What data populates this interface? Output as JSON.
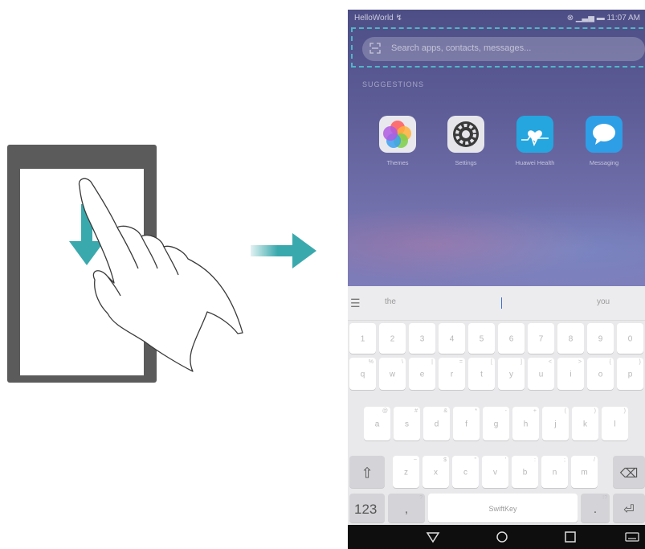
{
  "left_illustration": {
    "device": "tablet-outline",
    "gesture": "swipe-down-from-middle",
    "arrow_color": "#3aa9ad"
  },
  "transition_arrow": {
    "color": "#3aa9ad"
  },
  "phone": {
    "status_bar": {
      "carrier": "HelloWorld ↯",
      "right": "⊗ ▁▃▅ ▬ 11:07 AM"
    },
    "search": {
      "placeholder": "Search apps, contacts, messages...",
      "highlight_color": "#4fb6c6"
    },
    "suggestions_label": "SUGGESTIONS",
    "apps": [
      {
        "label": "Themes",
        "icon": "themes-icon"
      },
      {
        "label": "Settings",
        "icon": "settings-icon"
      },
      {
        "label": "Huawei Health",
        "icon": "health-icon"
      },
      {
        "label": "Messaging",
        "icon": "messaging-icon"
      }
    ],
    "keyboard": {
      "candidates": {
        "left": "the",
        "right": "you"
      },
      "row1": [
        "1",
        "2",
        "3",
        "4",
        "5",
        "6",
        "7",
        "8",
        "9",
        "0"
      ],
      "row2": [
        {
          "k": "q",
          "h": "%"
        },
        {
          "k": "w",
          "h": "\\"
        },
        {
          "k": "e",
          "h": "|"
        },
        {
          "k": "r",
          "h": "="
        },
        {
          "k": "t",
          "h": "["
        },
        {
          "k": "y",
          "h": "]"
        },
        {
          "k": "u",
          "h": "<"
        },
        {
          "k": "i",
          "h": ">"
        },
        {
          "k": "o",
          "h": "{"
        },
        {
          "k": "p",
          "h": "}"
        }
      ],
      "row3": [
        {
          "k": "a",
          "h": "@"
        },
        {
          "k": "s",
          "h": "#"
        },
        {
          "k": "d",
          "h": "&"
        },
        {
          "k": "f",
          "h": "*"
        },
        {
          "k": "g",
          "h": "-"
        },
        {
          "k": "h",
          "h": "+"
        },
        {
          "k": "j",
          "h": "("
        },
        {
          "k": "k",
          "h": ")"
        },
        {
          "k": "l",
          "h": ")"
        }
      ],
      "row4": [
        {
          "k": "z",
          "h": "~"
        },
        {
          "k": "x",
          "h": "$"
        },
        {
          "k": "c",
          "h": "\""
        },
        {
          "k": "v",
          "h": "'"
        },
        {
          "k": "b",
          "h": ":"
        },
        {
          "k": "n",
          "h": ";"
        },
        {
          "k": "m",
          "h": "/"
        }
      ],
      "shift": "⇧",
      "backspace": "⌫",
      "num_toggle": "123",
      "comma": ",",
      "comma_hint": "?",
      "space": "SwiftKey",
      "period": ".",
      "period_hint": "!?",
      "enter": "⏎"
    },
    "navbar": {
      "back": "back-icon",
      "home": "home-icon",
      "recents": "recents-icon",
      "keyboard": "keyboard-icon"
    }
  }
}
